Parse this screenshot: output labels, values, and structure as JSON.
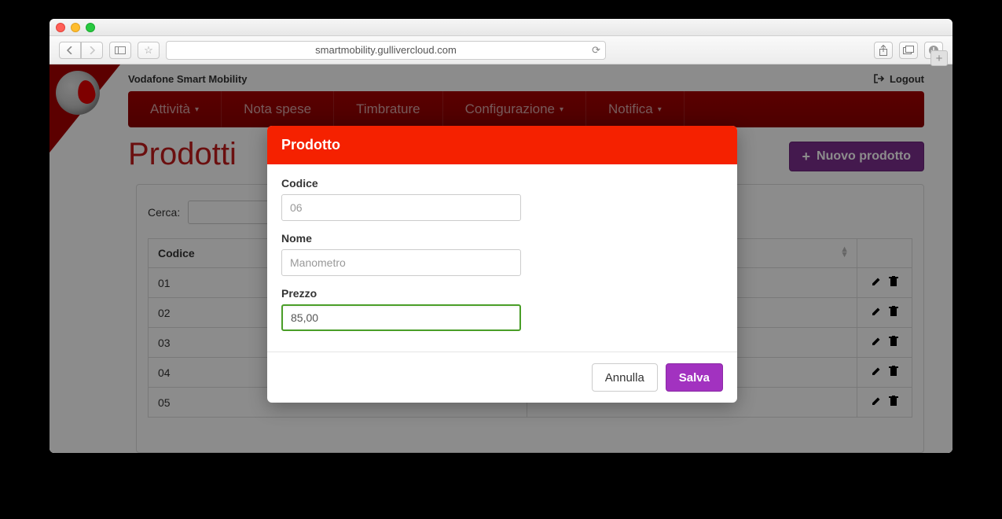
{
  "browser": {
    "url": "smartmobility.gullivercloud.com"
  },
  "header": {
    "brand": "Vodafone Smart Mobility",
    "logout": "Logout"
  },
  "nav": {
    "items": [
      {
        "label": "Attività",
        "caret": true
      },
      {
        "label": "Nota spese",
        "caret": false
      },
      {
        "label": "Timbrature",
        "caret": false
      },
      {
        "label": "Configurazione",
        "caret": true
      },
      {
        "label": "Notifica",
        "caret": true
      }
    ]
  },
  "page": {
    "title": "Prodotti",
    "new_button": "Nuovo prodotto"
  },
  "search": {
    "label": "Cerca:",
    "value": ""
  },
  "table": {
    "columns": [
      "Codice"
    ],
    "rows": [
      {
        "codice": "01"
      },
      {
        "codice": "02"
      },
      {
        "codice": "03"
      },
      {
        "codice": "04"
      },
      {
        "codice": "05"
      }
    ]
  },
  "modal": {
    "title": "Prodotto",
    "fields": {
      "codice": {
        "label": "Codice",
        "placeholder": "06"
      },
      "nome": {
        "label": "Nome",
        "placeholder": "Manometro"
      },
      "prezzo": {
        "label": "Prezzo",
        "value": "85,00"
      }
    },
    "buttons": {
      "cancel": "Annulla",
      "save": "Salva"
    }
  }
}
